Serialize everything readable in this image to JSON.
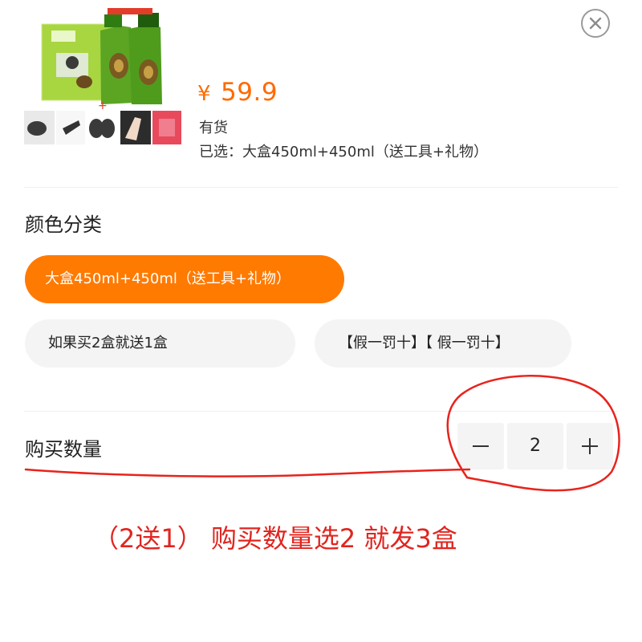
{
  "product": {
    "price_currency": "¥",
    "price": "59.9",
    "stock": "有货",
    "selected_text": "已选：大盒450ml+450ml（送工具+礼物）",
    "accent_color": "#ff7a00"
  },
  "color_section": {
    "title": "颜色分类",
    "options": [
      {
        "label": "大盒450ml+450ml（送工具+礼物）",
        "selected": true
      },
      {
        "label": "如果买2盒就送1盒",
        "selected": false
      },
      {
        "label": "【假一罚十】【 假一罚十】",
        "selected": false
      }
    ]
  },
  "quantity_section": {
    "title": "购买数量",
    "value": "2",
    "minus_icon": "minus-icon",
    "plus_icon": "plus-icon"
  },
  "annotation": {
    "promo_text": "（2送1） 购买数量选2 就发3盒",
    "color": "#e0251f"
  },
  "icons": {
    "close": "close-icon"
  }
}
